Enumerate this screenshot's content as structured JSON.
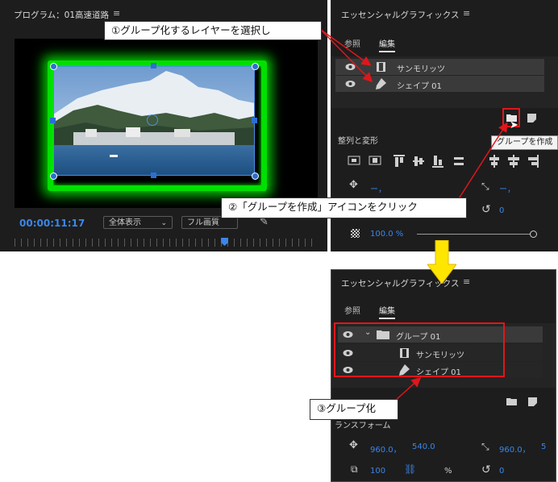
{
  "program_monitor": {
    "title": "プログラム：01高速道路",
    "menu_glyph": "≡",
    "timecode": "00:00:11:17",
    "zoom_dropdown": "全体表示",
    "quality_dropdown": "フル画質"
  },
  "essential_graphics_top": {
    "title": "エッセンシャルグラフィックス",
    "menu_glyph": "≡",
    "tabs": [
      "参照",
      "編集"
    ],
    "layers": [
      {
        "name": "サンモリッツ",
        "icon": "film-icon"
      },
      {
        "name": "シェイプ 01",
        "icon": "pen-icon"
      }
    ],
    "tooltip": "グループを作成",
    "section_align": "整列と変形",
    "position_text": "ー，",
    "scale_text": "ー，",
    "rotation_text": "0",
    "opacity_text": "100.0 %"
  },
  "essential_graphics_bottom": {
    "title": "エッセンシャルグラフィックス",
    "menu_glyph": "≡",
    "tabs": [
      "参照",
      "編集"
    ],
    "group": {
      "name": "グループ 01",
      "icon": "folder-icon"
    },
    "children": [
      {
        "name": "サンモリッツ",
        "icon": "film-icon"
      },
      {
        "name": "シェイプ 01",
        "icon": "pen-icon"
      }
    ],
    "section_partial": "ランスフォーム",
    "position_x": "960.0，",
    "position_y": "540.0",
    "scale_value": "960.0，",
    "scale_cut": "5",
    "scale_pct": "100",
    "pct_sign": "%",
    "rotation_value": "0"
  },
  "annotations": {
    "step1": "①グループ化するレイヤーを選択し",
    "step2": "②「グループを作成」アイコンをクリック",
    "step3": "③グループ化"
  },
  "colors": {
    "accent_blue": "#3b86e8",
    "callout_red": "#e0161b",
    "arrow_yellow": "#ffe600",
    "shape_green": "#00e000"
  }
}
